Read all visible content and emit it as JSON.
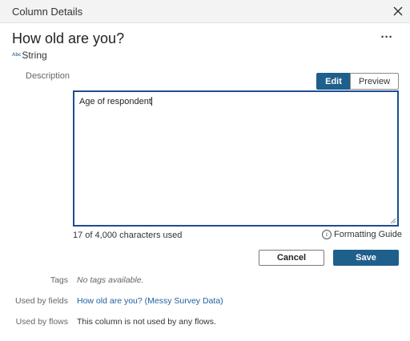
{
  "window": {
    "title": "Column Details"
  },
  "column": {
    "name": "How old are you?",
    "type_icon": "Abc",
    "type_label": "String"
  },
  "description": {
    "label": "Description",
    "tabs": {
      "edit": "Edit",
      "preview": "Preview",
      "active": "Edit"
    },
    "value": "Age of respondent",
    "char_count": "17 of 4,000 characters used",
    "formatting_guide": "Formatting Guide"
  },
  "actions": {
    "cancel": "Cancel",
    "save": "Save"
  },
  "meta": {
    "tags_label": "Tags",
    "tags_value": "No tags available.",
    "fields_label": "Used by fields",
    "fields_value": "How old are you? (Messy Survey Data)",
    "flows_label": "Used by flows",
    "flows_value": "This column is not used by any flows."
  },
  "icons": {
    "close": "close-icon",
    "more": "more-options-icon",
    "info": "info-icon",
    "type": "string-type-icon",
    "resize": "resize-handle-icon"
  },
  "colors": {
    "accent": "#1f5f8b",
    "link": "#1f5f9e",
    "focus_border": "#1f4e8c",
    "titlebar_bg": "#f3f3f3"
  }
}
